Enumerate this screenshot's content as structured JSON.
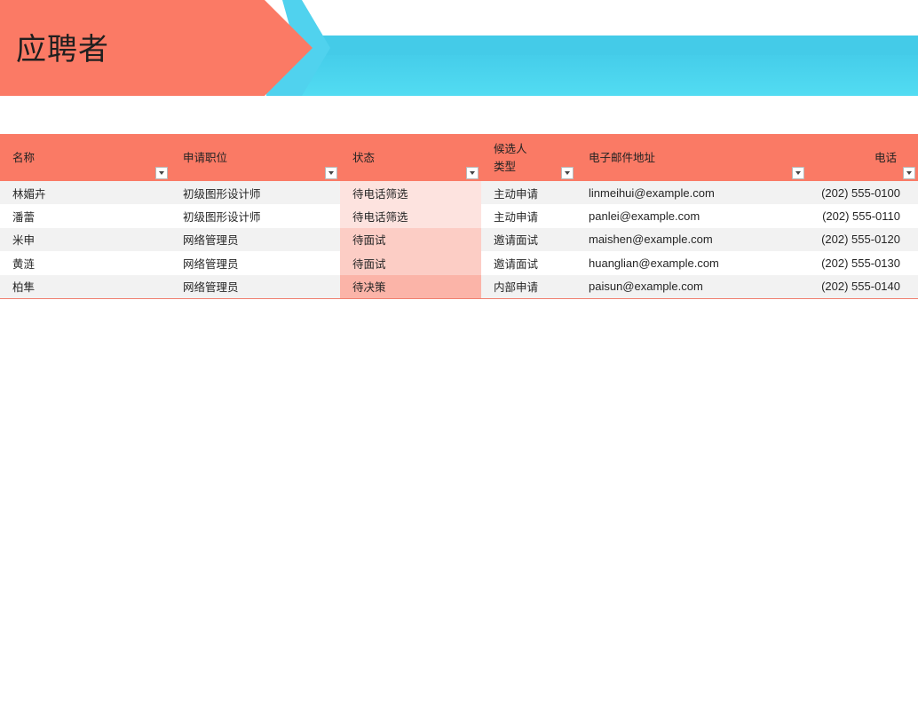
{
  "header": {
    "title": "应聘者"
  },
  "colors": {
    "banner_coral": "#fb7a65",
    "banner_blue": "#45cfe9",
    "header_row": "#fa7a65"
  },
  "table": {
    "columns": [
      {
        "label": "名称"
      },
      {
        "label": "申请职位"
      },
      {
        "label": "状态"
      },
      {
        "label": "候选人\n类型"
      },
      {
        "label": "电子邮件地址"
      },
      {
        "label": "电话"
      }
    ],
    "rows": [
      {
        "name": "林媚卉",
        "position": "初级图形设计师",
        "status": "待电话筛选",
        "status_color": "#fde3df",
        "type": "主动申请",
        "email": "linmeihui@example.com",
        "phone": "(202) 555-0100"
      },
      {
        "name": "潘蕾",
        "position": "初级图形设计师",
        "status": "待电话筛选",
        "status_color": "#fde3df",
        "type": "主动申请",
        "email": "panlei@example.com",
        "phone": "(202) 555-0110"
      },
      {
        "name": "米申",
        "position": "网络管理员",
        "status": "待面试",
        "status_color": "#fccdc5",
        "type": "邀请面试",
        "email": "maishen@example.com",
        "phone": "(202) 555-0120"
      },
      {
        "name": "黄涟",
        "position": "网络管理员",
        "status": "待面试",
        "status_color": "#fccdc5",
        "type": "邀请面试",
        "email": "huanglian@example.com",
        "phone": "(202) 555-0130"
      },
      {
        "name": "柏隼",
        "position": "网络管理员",
        "status": "待决策",
        "status_color": "#fbb4a8",
        "type": "内部申请",
        "email": "paisun@example.com",
        "phone": "(202) 555-0140"
      }
    ]
  }
}
